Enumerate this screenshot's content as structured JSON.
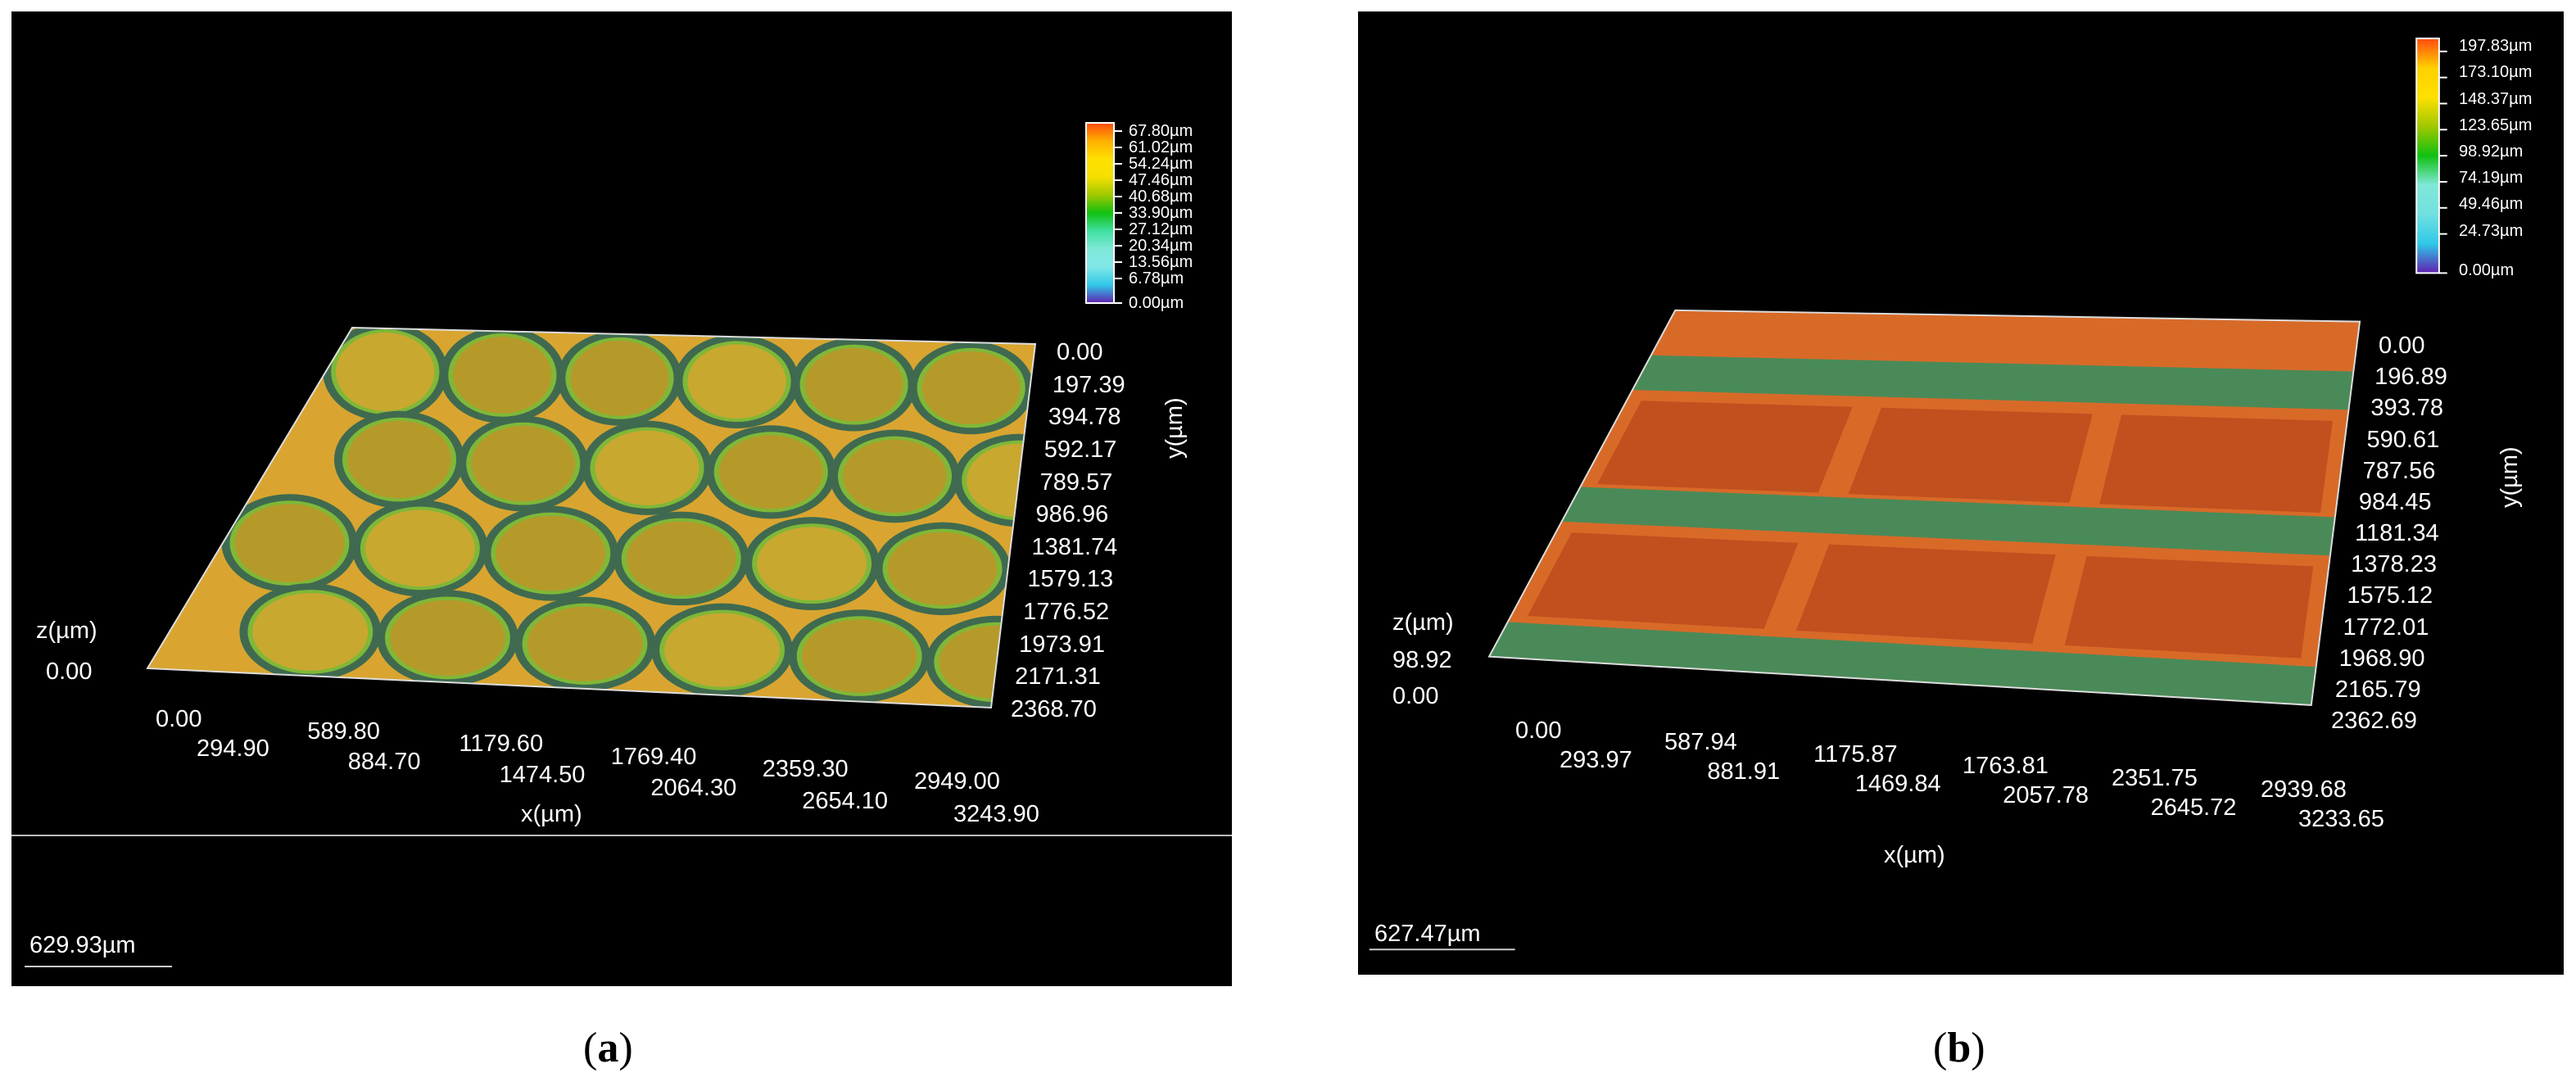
{
  "panels": [
    {
      "id": "a",
      "caption": "a",
      "scale_bar": "629.93µm",
      "legend": [
        "67.80µm",
        "61.02µm",
        "54.24µm",
        "47.46µm",
        "40.68µm",
        "33.90µm",
        "27.12µm",
        "20.34µm",
        "13.56µm",
        "6.78µm",
        "0.00µm"
      ],
      "y_axis_title": "y(µm)",
      "y_ticks": [
        "0.00",
        "197.39",
        "394.78",
        "592.17",
        "789.57",
        "986.96",
        "1381.74",
        "1579.13",
        "1776.52",
        "1973.91",
        "2171.31",
        "2368.70"
      ],
      "x_axis_title": "x(µm)",
      "x_ticks": [
        "0.00",
        "294.90",
        "589.80",
        "884.70",
        "1179.60",
        "1474.50",
        "1769.40",
        "2064.30",
        "2359.30",
        "2654.10",
        "2949.00",
        "3243.90"
      ],
      "z_axis_title": "z(µm)",
      "z_ticks": [
        "0.00"
      ]
    },
    {
      "id": "b",
      "caption": "b",
      "scale_bar": "627.47µm",
      "legend": [
        "197.83µm",
        "173.10µm",
        "148.37µm",
        "123.65µm",
        "98.92µm",
        "74.19µm",
        "49.46µm",
        "24.73µm",
        "0.00µm"
      ],
      "y_axis_title": "y(µm)",
      "y_ticks": [
        "0.00",
        "196.89",
        "393.78",
        "590.61",
        "787.56",
        "984.45",
        "1181.34",
        "1378.23",
        "1575.12",
        "1772.01",
        "1968.90",
        "2165.79",
        "2362.69"
      ],
      "x_axis_title": "x(µm)",
      "x_ticks": [
        "0.00",
        "293.97",
        "587.94",
        "881.91",
        "1175.87",
        "1469.84",
        "1763.81",
        "2057.78",
        "2351.75",
        "2645.72",
        "2939.68",
        "3233.65"
      ],
      "z_axis_title": "z(µm)",
      "z_ticks": [
        "98.92",
        "0.00"
      ]
    }
  ],
  "colors": {
    "background": "#000000",
    "surface_a": "#d9a530",
    "surface_b": "#d86a28"
  }
}
